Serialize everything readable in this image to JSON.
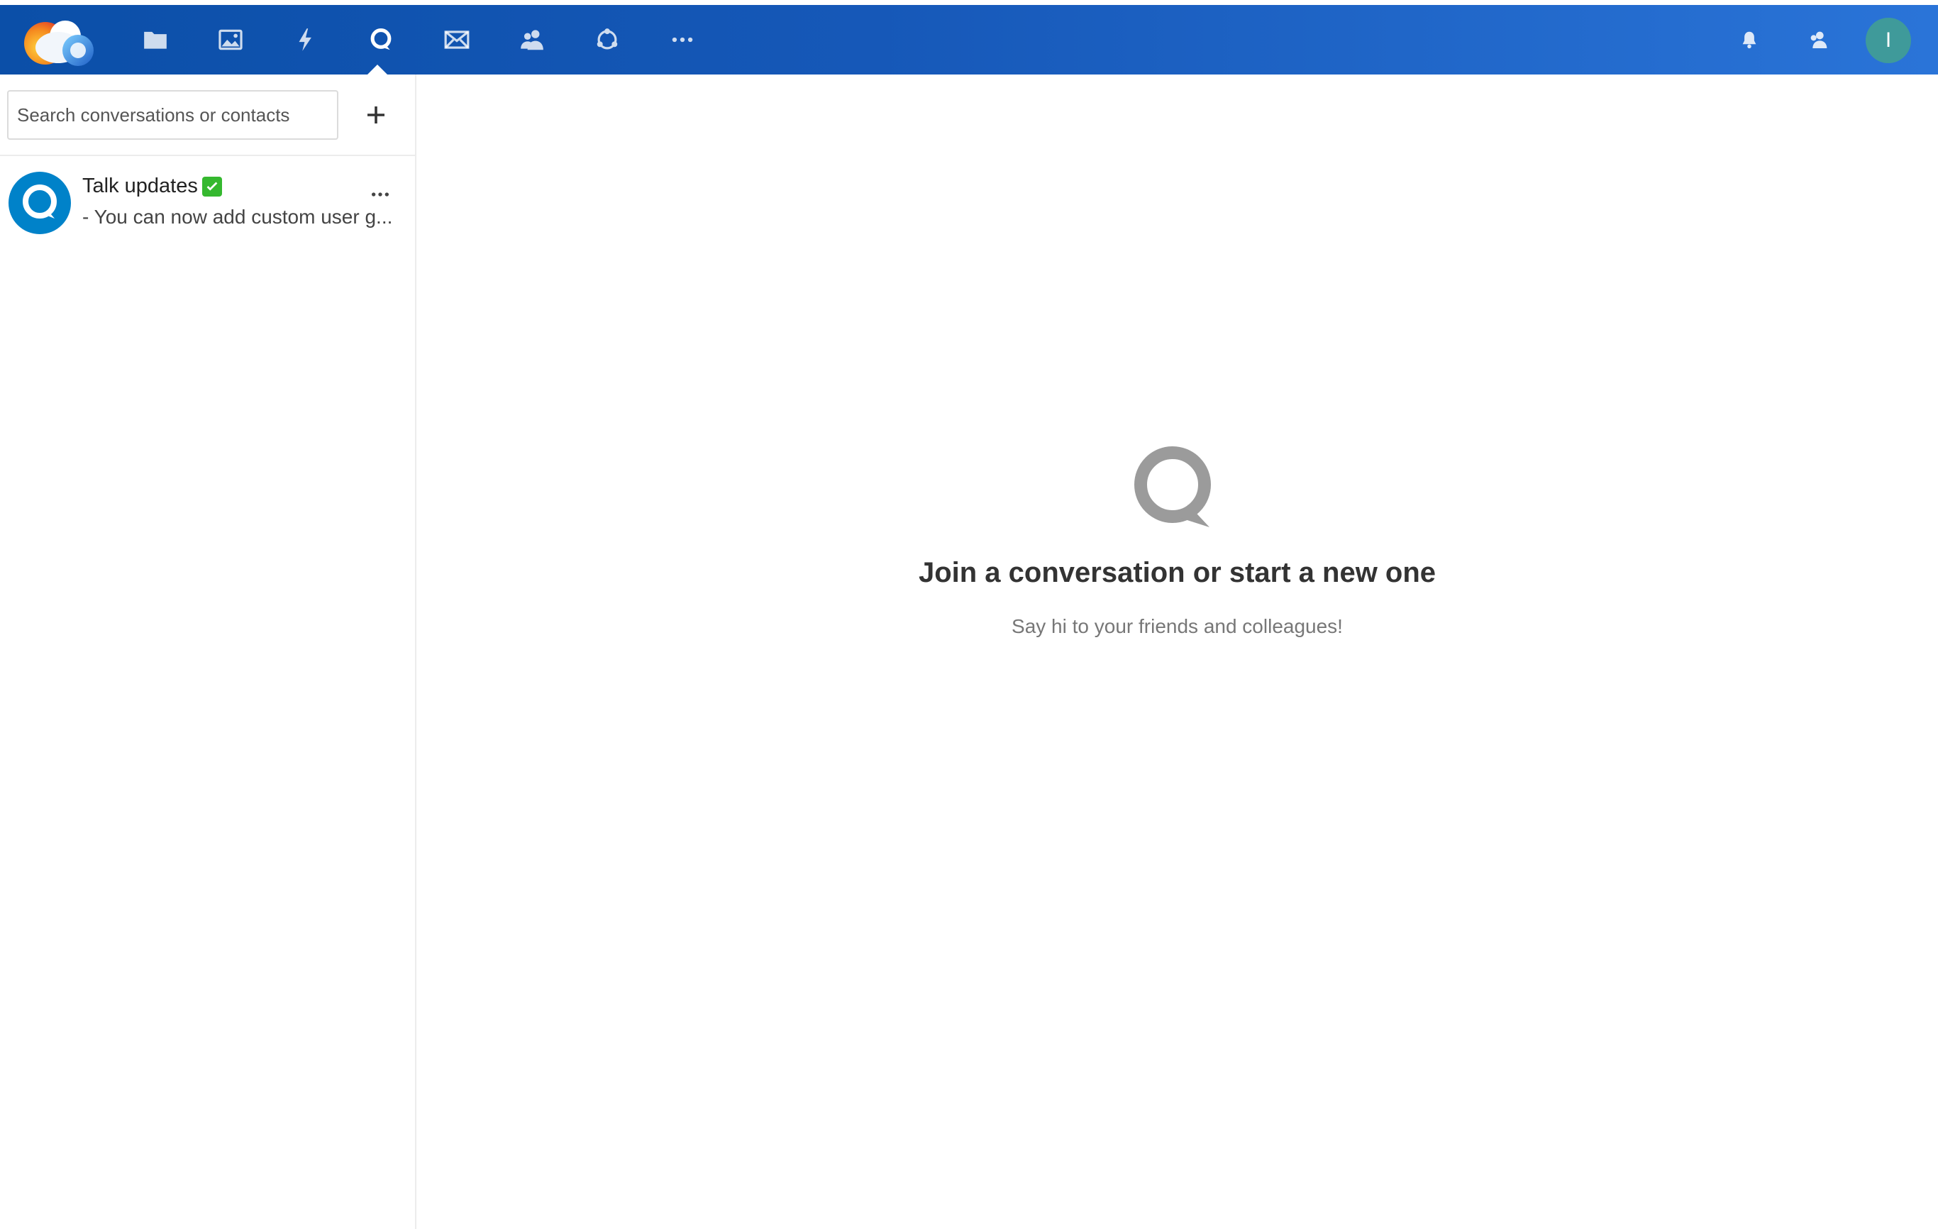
{
  "header": {
    "nav": [
      {
        "name": "files",
        "icon": "folder-icon"
      },
      {
        "name": "photos",
        "icon": "image-icon"
      },
      {
        "name": "activity",
        "icon": "lightning-icon"
      },
      {
        "name": "talk",
        "icon": "talk-icon",
        "active": true
      },
      {
        "name": "mail",
        "icon": "mail-icon"
      },
      {
        "name": "contacts",
        "icon": "contacts-icon"
      },
      {
        "name": "circles",
        "icon": "circles-icon"
      },
      {
        "name": "more",
        "icon": "more-icon"
      }
    ],
    "right_icons": [
      "bell-icon",
      "contacts-menu-icon"
    ],
    "avatar_initial": "I",
    "colors": {
      "gradient_start": "#0b4fa8",
      "gradient_end": "#2a74d8",
      "avatar_bg": "#3f9a9a"
    }
  },
  "sidebar": {
    "search": {
      "placeholder": "Search conversations or contacts",
      "value": ""
    },
    "conversations": [
      {
        "name": "Talk updates",
        "verified": true,
        "preview": "- You can now add custom user g..."
      }
    ]
  },
  "main": {
    "empty_title": "Join a conversation or start a new one",
    "empty_subtitle": "Say hi to your friends and colleagues!"
  }
}
